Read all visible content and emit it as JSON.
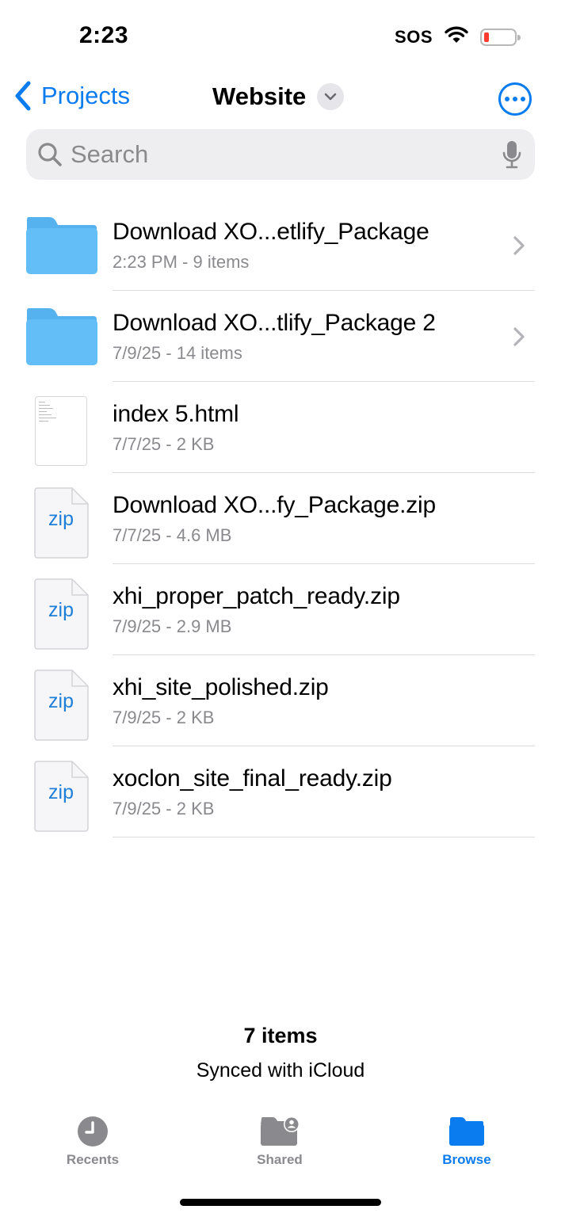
{
  "status_bar": {
    "time": "2:23",
    "carrier": "SOS",
    "icons": [
      "wifi-icon",
      "battery-low-icon"
    ]
  },
  "nav": {
    "back_label": "Projects",
    "title": "Website",
    "icons": [
      "chevron-left-icon",
      "chevron-down-icon",
      "more-ellipsis-icon"
    ]
  },
  "search": {
    "placeholder": "Search",
    "value": "",
    "icons": [
      "search-icon",
      "microphone-icon"
    ]
  },
  "files": [
    {
      "name": "Download XO...etlify_Package",
      "meta": "2:23 PM - 9 items",
      "kind": "folder"
    },
    {
      "name": "Download XO...tlify_Package 2",
      "meta": "7/9/25 - 14 items",
      "kind": "folder"
    },
    {
      "name": "index 5.html",
      "meta": "7/7/25 - 2 KB",
      "kind": "html"
    },
    {
      "name": "Download XO...fy_Package.zip",
      "meta": "7/7/25 - 4.6 MB",
      "kind": "zip"
    },
    {
      "name": "xhi_proper_patch_ready.zip",
      "meta": "7/9/25 - 2.9 MB",
      "kind": "zip"
    },
    {
      "name": "xhi_site_polished.zip",
      "meta": "7/9/25 - 2 KB",
      "kind": "zip"
    },
    {
      "name": "xoclon_site_final_ready.zip",
      "meta": "7/9/25 - 2 KB",
      "kind": "zip"
    }
  ],
  "zip_icon_label": "zip",
  "summary": {
    "count": "7 items",
    "sync_status": "Synced with iCloud"
  },
  "tabs": [
    {
      "label": "Recents",
      "icon": "clock-icon",
      "active": false
    },
    {
      "label": "Shared",
      "icon": "shared-folder-icon",
      "active": false
    },
    {
      "label": "Browse",
      "icon": "folder-icon",
      "active": true
    }
  ],
  "colors": {
    "accent": "#0a7cf0",
    "folder": "#5ab8f5",
    "secondary_text": "#8a8a8e",
    "battery_low": "#ff3b30"
  }
}
